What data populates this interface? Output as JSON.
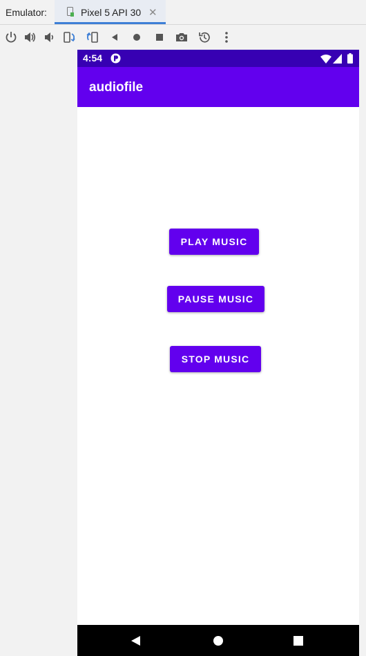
{
  "emulator": {
    "label": "Emulator:",
    "tab_title": "Pixel 5 API 30",
    "tab_close": "✕"
  },
  "toolbar_icons": [
    "power-icon",
    "volume-up-icon",
    "volume-down-icon",
    "rotate-left-icon",
    "rotate-right-icon",
    "back-icon",
    "home-icon",
    "overview-icon",
    "camera-icon",
    "snapshot-icon",
    "more-icon"
  ],
  "device": {
    "status_time": "4:54",
    "app_title": "audiofile",
    "buttons": {
      "play": "PLAY MUSIC",
      "pause": "PAUSE MUSIC",
      "stop": "STOP MUSIC"
    }
  },
  "colors": {
    "status_bar": "#3700b3",
    "primary": "#6200ee",
    "tab_underline": "#3d7fd6"
  }
}
